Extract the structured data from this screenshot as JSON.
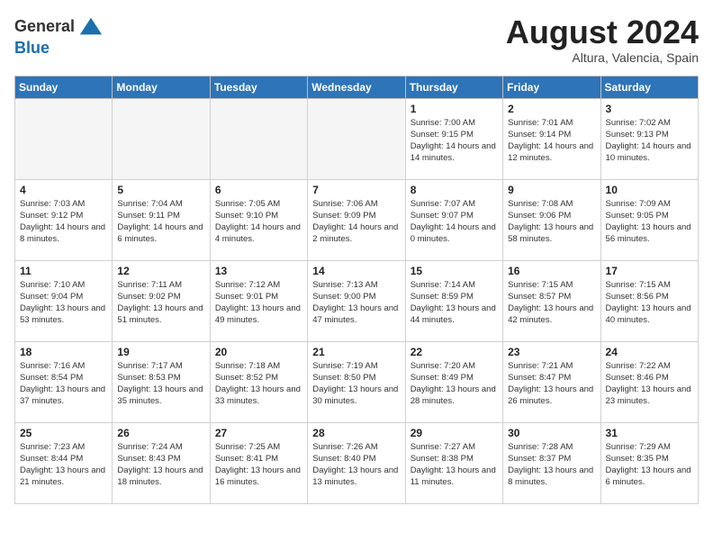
{
  "header": {
    "logo_line1": "General",
    "logo_line2": "Blue",
    "month": "August 2024",
    "location": "Altura, Valencia, Spain"
  },
  "days_of_week": [
    "Sunday",
    "Monday",
    "Tuesday",
    "Wednesday",
    "Thursday",
    "Friday",
    "Saturday"
  ],
  "weeks": [
    [
      {
        "day": "",
        "empty": true
      },
      {
        "day": "",
        "empty": true
      },
      {
        "day": "",
        "empty": true
      },
      {
        "day": "",
        "empty": true
      },
      {
        "day": "1",
        "sunrise": "7:00 AM",
        "sunset": "9:15 PM",
        "daylight": "14 hours and 14 minutes."
      },
      {
        "day": "2",
        "sunrise": "7:01 AM",
        "sunset": "9:14 PM",
        "daylight": "14 hours and 12 minutes."
      },
      {
        "day": "3",
        "sunrise": "7:02 AM",
        "sunset": "9:13 PM",
        "daylight": "14 hours and 10 minutes."
      }
    ],
    [
      {
        "day": "4",
        "sunrise": "7:03 AM",
        "sunset": "9:12 PM",
        "daylight": "14 hours and 8 minutes."
      },
      {
        "day": "5",
        "sunrise": "7:04 AM",
        "sunset": "9:11 PM",
        "daylight": "14 hours and 6 minutes."
      },
      {
        "day": "6",
        "sunrise": "7:05 AM",
        "sunset": "9:10 PM",
        "daylight": "14 hours and 4 minutes."
      },
      {
        "day": "7",
        "sunrise": "7:06 AM",
        "sunset": "9:09 PM",
        "daylight": "14 hours and 2 minutes."
      },
      {
        "day": "8",
        "sunrise": "7:07 AM",
        "sunset": "9:07 PM",
        "daylight": "14 hours and 0 minutes."
      },
      {
        "day": "9",
        "sunrise": "7:08 AM",
        "sunset": "9:06 PM",
        "daylight": "13 hours and 58 minutes."
      },
      {
        "day": "10",
        "sunrise": "7:09 AM",
        "sunset": "9:05 PM",
        "daylight": "13 hours and 56 minutes."
      }
    ],
    [
      {
        "day": "11",
        "sunrise": "7:10 AM",
        "sunset": "9:04 PM",
        "daylight": "13 hours and 53 minutes."
      },
      {
        "day": "12",
        "sunrise": "7:11 AM",
        "sunset": "9:02 PM",
        "daylight": "13 hours and 51 minutes."
      },
      {
        "day": "13",
        "sunrise": "7:12 AM",
        "sunset": "9:01 PM",
        "daylight": "13 hours and 49 minutes."
      },
      {
        "day": "14",
        "sunrise": "7:13 AM",
        "sunset": "9:00 PM",
        "daylight": "13 hours and 47 minutes."
      },
      {
        "day": "15",
        "sunrise": "7:14 AM",
        "sunset": "8:59 PM",
        "daylight": "13 hours and 44 minutes."
      },
      {
        "day": "16",
        "sunrise": "7:15 AM",
        "sunset": "8:57 PM",
        "daylight": "13 hours and 42 minutes."
      },
      {
        "day": "17",
        "sunrise": "7:15 AM",
        "sunset": "8:56 PM",
        "daylight": "13 hours and 40 minutes."
      }
    ],
    [
      {
        "day": "18",
        "sunrise": "7:16 AM",
        "sunset": "8:54 PM",
        "daylight": "13 hours and 37 minutes."
      },
      {
        "day": "19",
        "sunrise": "7:17 AM",
        "sunset": "8:53 PM",
        "daylight": "13 hours and 35 minutes."
      },
      {
        "day": "20",
        "sunrise": "7:18 AM",
        "sunset": "8:52 PM",
        "daylight": "13 hours and 33 minutes."
      },
      {
        "day": "21",
        "sunrise": "7:19 AM",
        "sunset": "8:50 PM",
        "daylight": "13 hours and 30 minutes."
      },
      {
        "day": "22",
        "sunrise": "7:20 AM",
        "sunset": "8:49 PM",
        "daylight": "13 hours and 28 minutes."
      },
      {
        "day": "23",
        "sunrise": "7:21 AM",
        "sunset": "8:47 PM",
        "daylight": "13 hours and 26 minutes."
      },
      {
        "day": "24",
        "sunrise": "7:22 AM",
        "sunset": "8:46 PM",
        "daylight": "13 hours and 23 minutes."
      }
    ],
    [
      {
        "day": "25",
        "sunrise": "7:23 AM",
        "sunset": "8:44 PM",
        "daylight": "13 hours and 21 minutes."
      },
      {
        "day": "26",
        "sunrise": "7:24 AM",
        "sunset": "8:43 PM",
        "daylight": "13 hours and 18 minutes."
      },
      {
        "day": "27",
        "sunrise": "7:25 AM",
        "sunset": "8:41 PM",
        "daylight": "13 hours and 16 minutes."
      },
      {
        "day": "28",
        "sunrise": "7:26 AM",
        "sunset": "8:40 PM",
        "daylight": "13 hours and 13 minutes."
      },
      {
        "day": "29",
        "sunrise": "7:27 AM",
        "sunset": "8:38 PM",
        "daylight": "13 hours and 11 minutes."
      },
      {
        "day": "30",
        "sunrise": "7:28 AM",
        "sunset": "8:37 PM",
        "daylight": "13 hours and 8 minutes."
      },
      {
        "day": "31",
        "sunrise": "7:29 AM",
        "sunset": "8:35 PM",
        "daylight": "13 hours and 6 minutes."
      }
    ]
  ]
}
